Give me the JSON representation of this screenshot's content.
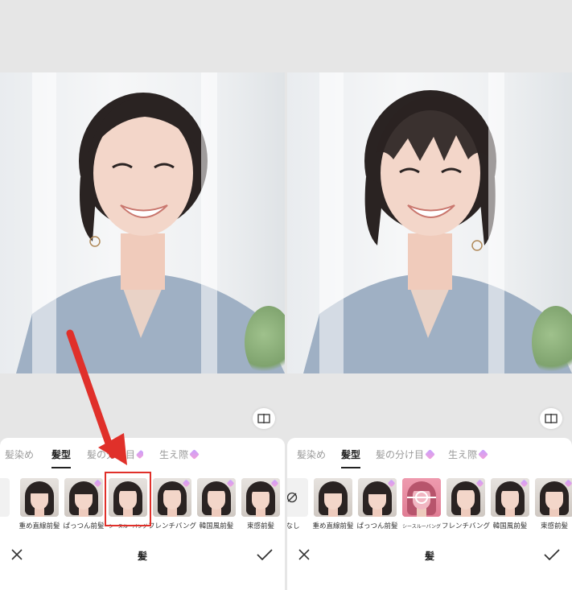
{
  "left": {
    "tabs": [
      {
        "label": "髪染め",
        "active": false,
        "premium": false
      },
      {
        "label": "髪型",
        "active": true,
        "premium": false
      },
      {
        "label": "髪の分け目",
        "active": false,
        "premium": true
      },
      {
        "label": "生え際",
        "active": false,
        "premium": true
      }
    ],
    "items": [
      {
        "label": "し"
      },
      {
        "label": "重め直線前髪"
      },
      {
        "label": "ぱっつん前髪"
      },
      {
        "label": "シースルーバング"
      },
      {
        "label": "フレンチバング"
      },
      {
        "label": "韓国風前髪"
      },
      {
        "label": "束感前髪"
      }
    ],
    "title": "髪"
  },
  "right": {
    "tabs": [
      {
        "label": "髪染め",
        "active": false,
        "premium": false
      },
      {
        "label": "髪型",
        "active": true,
        "premium": false
      },
      {
        "label": "髪の分け目",
        "active": false,
        "premium": true
      },
      {
        "label": "生え際",
        "active": false,
        "premium": true
      }
    ],
    "items": [
      {
        "label": "なし"
      },
      {
        "label": "重め直線前髪"
      },
      {
        "label": "ぱっつん前髪"
      },
      {
        "label": "シースルーバング"
      },
      {
        "label": "フレンチバング"
      },
      {
        "label": "韓国風前髪"
      },
      {
        "label": "束感前髪"
      }
    ],
    "title": "髪"
  },
  "colors": {
    "accent_red": "#e0302a",
    "hair": "#2a2322",
    "shirt": "#9fb0c4"
  }
}
